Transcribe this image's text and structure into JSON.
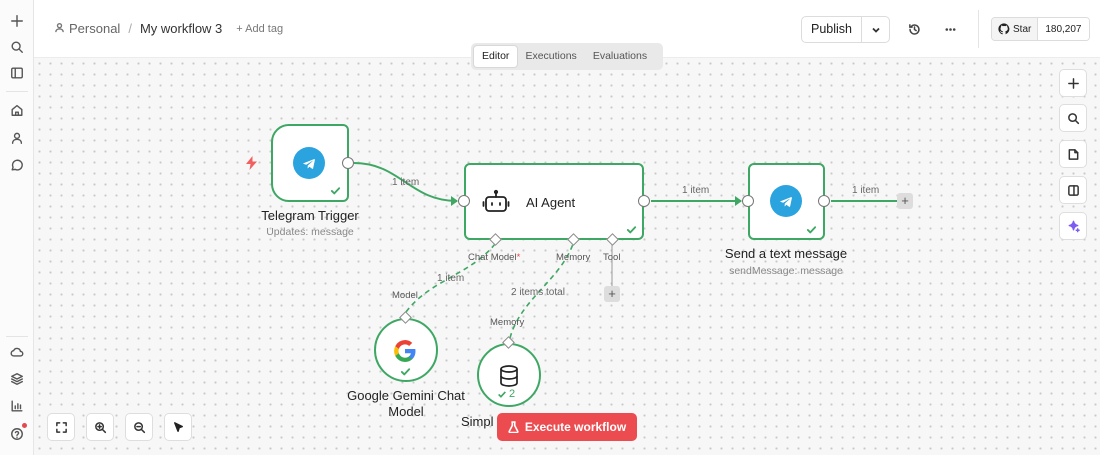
{
  "breadcrumb": {
    "project": "Personal",
    "separator": "/",
    "workflow": "My workflow 3",
    "add_tag": "+ Add tag"
  },
  "header": {
    "publish_label": "Publish",
    "github_star_label": "Star",
    "github_stars": "180,207"
  },
  "tabs": [
    {
      "label": "Editor",
      "active": true
    },
    {
      "label": "Executions",
      "active": false
    },
    {
      "label": "Evaluations",
      "active": false
    }
  ],
  "nodes": {
    "telegram_trigger": {
      "title": "Telegram Trigger",
      "subtitle": "Updates: message"
    },
    "ai_agent": {
      "title": "AI Agent",
      "port_chat_model": "Chat Model",
      "port_memory": "Memory",
      "port_tool": "Tool"
    },
    "send_message": {
      "title": "Send a text message",
      "subtitle": "sendMessage: message"
    },
    "gemini": {
      "title_line1": "Google Gemini Chat",
      "title_line2": "Model",
      "port_label": "Model"
    },
    "memory": {
      "title": "Simpl",
      "port_label": "Memory",
      "run_count": "2"
    }
  },
  "connections": {
    "trigger_to_agent": "1 item",
    "agent_to_send": "1 item",
    "send_out": "1 item",
    "gemini_link": "1 item",
    "memory_link": "2 items total"
  },
  "execute_button": {
    "label": "Execute workflow"
  },
  "colors": {
    "success": "#3fa764",
    "execute": "#ec4c4f",
    "telegram": "#2aa3df"
  }
}
